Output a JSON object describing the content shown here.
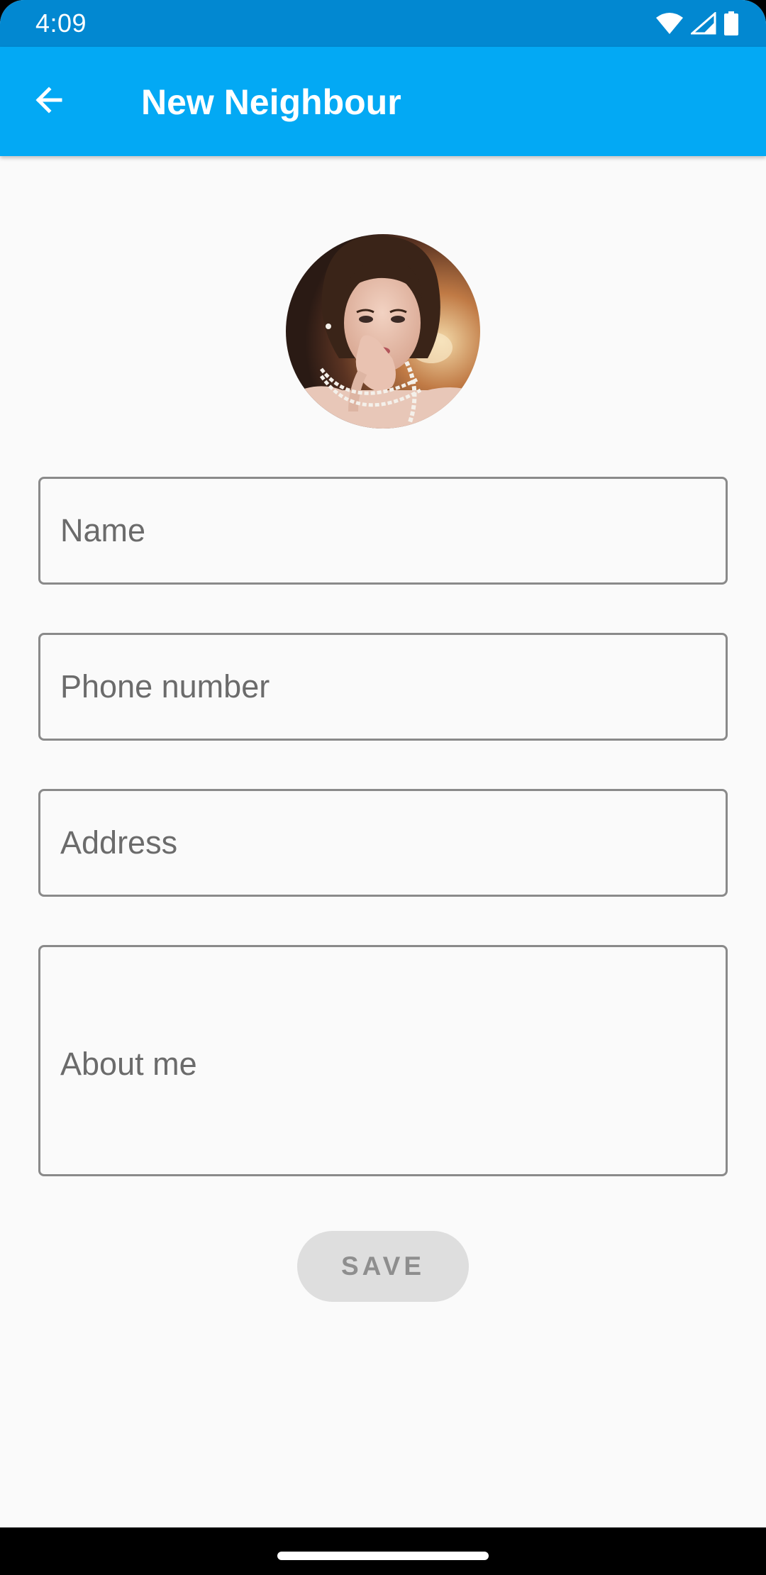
{
  "status_bar": {
    "time": "4:09",
    "icons": [
      "wifi-icon",
      "signal-icon",
      "battery-icon"
    ],
    "background": "#0288D1"
  },
  "app_bar": {
    "title": "New Neighbour",
    "back_icon": "arrow-back-icon",
    "background": "#03A9F4"
  },
  "avatar": {
    "icon": "profile-photo"
  },
  "form": {
    "name_placeholder": "Name",
    "phone_placeholder": "Phone number",
    "address_placeholder": "Address",
    "about_placeholder": "About me",
    "name_value": "",
    "phone_value": "",
    "address_value": "",
    "about_value": ""
  },
  "save_button": {
    "label": "SAVE",
    "enabled": false
  },
  "nav_bar": {
    "handle_icon": "home-gesture-handle"
  }
}
